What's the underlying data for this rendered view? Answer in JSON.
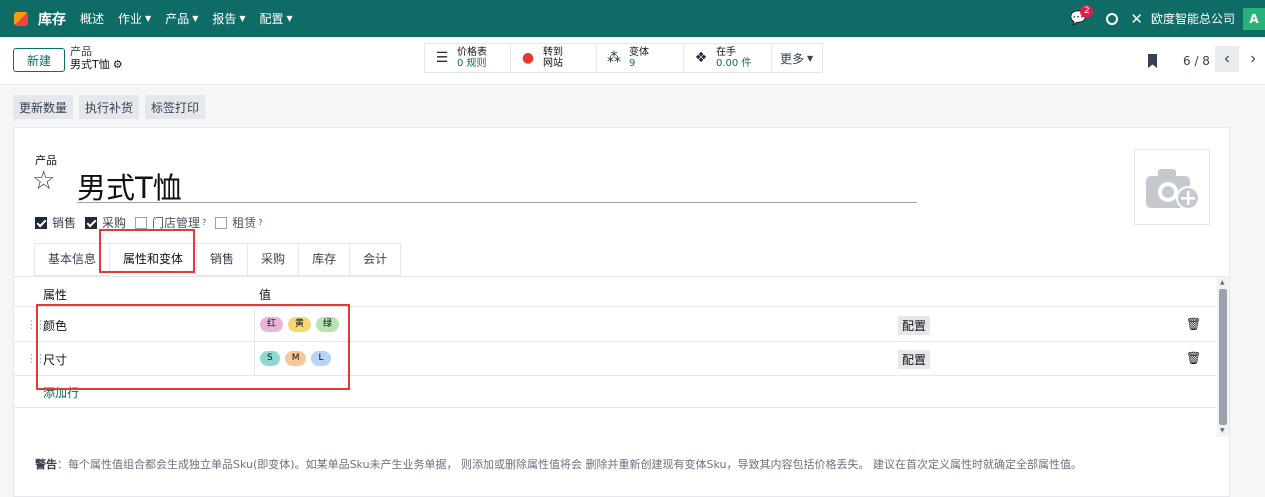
{
  "navbar": {
    "app_name": "库存",
    "menus": [
      {
        "label": "概述",
        "caret": false
      },
      {
        "label": "作业",
        "caret": true
      },
      {
        "label": "产品",
        "caret": true
      },
      {
        "label": "报告",
        "caret": true
      },
      {
        "label": "配置",
        "caret": true
      }
    ],
    "chat_count": "2",
    "company": "欧度智能总公司",
    "avatar_letter": "A"
  },
  "control": {
    "new_button": "新建",
    "breadcrumb_parent": "产品",
    "breadcrumb_current": "男式T恤",
    "smart_buttons": [
      {
        "icon": "list-icon",
        "line1": "价格表",
        "line2": "0 规则"
      },
      {
        "icon": "globe-icon",
        "line1": "转到",
        "line2": "网站"
      },
      {
        "icon": "sitemap-icon",
        "line1": "变体",
        "line2": "9"
      },
      {
        "icon": "cubes-icon",
        "line1": "在手",
        "line2": "0.00 件"
      }
    ],
    "more_button": "更多",
    "pager": "6 / 8"
  },
  "actions": [
    "更新数量",
    "执行补货",
    "标签打印"
  ],
  "form": {
    "name_label": "产品",
    "product_name": "男式T恤",
    "checkboxes": [
      {
        "label": "销售",
        "checked": true,
        "help": false
      },
      {
        "label": "采购",
        "checked": true,
        "help": false
      },
      {
        "label": "门店管理",
        "checked": false,
        "help": true
      },
      {
        "label": "租赁",
        "checked": false,
        "help": true
      }
    ],
    "help_mark": "?",
    "tabs": [
      "基本信息",
      "属性和变体",
      "销售",
      "采购",
      "库存",
      "会计"
    ],
    "active_tab": "属性和变体",
    "table": {
      "col_attribute": "属性",
      "col_value": "值",
      "rows": [
        {
          "name": "颜色",
          "tags": [
            {
              "label": "红",
              "color": "#e9b6d8"
            },
            {
              "label": "黄",
              "color": "#f7d774"
            },
            {
              "label": "绿",
              "color": "#b7e4b3"
            }
          ],
          "configure": "配置"
        },
        {
          "name": "尺寸",
          "tags": [
            {
              "label": "S",
              "color": "#8fd8cf"
            },
            {
              "label": "M",
              "color": "#f5c89a"
            },
            {
              "label": "L",
              "color": "#b8d3f5"
            }
          ],
          "configure": "配置"
        }
      ],
      "add_line": "添加行"
    },
    "warning_label": "警告",
    "warning_text": "：每个属性值组合都会生成独立单品Sku(即变体)。如某单品Sku未产生业务单据， 则添加或删除属性值将会 删除并重新创建现有变体Sku，导致其内容包括价格丢失。 建议在首次定义属性时就确定全部属性值。"
  },
  "colors": {
    "brand": "#0f6b65",
    "highlight": "#e53935"
  }
}
